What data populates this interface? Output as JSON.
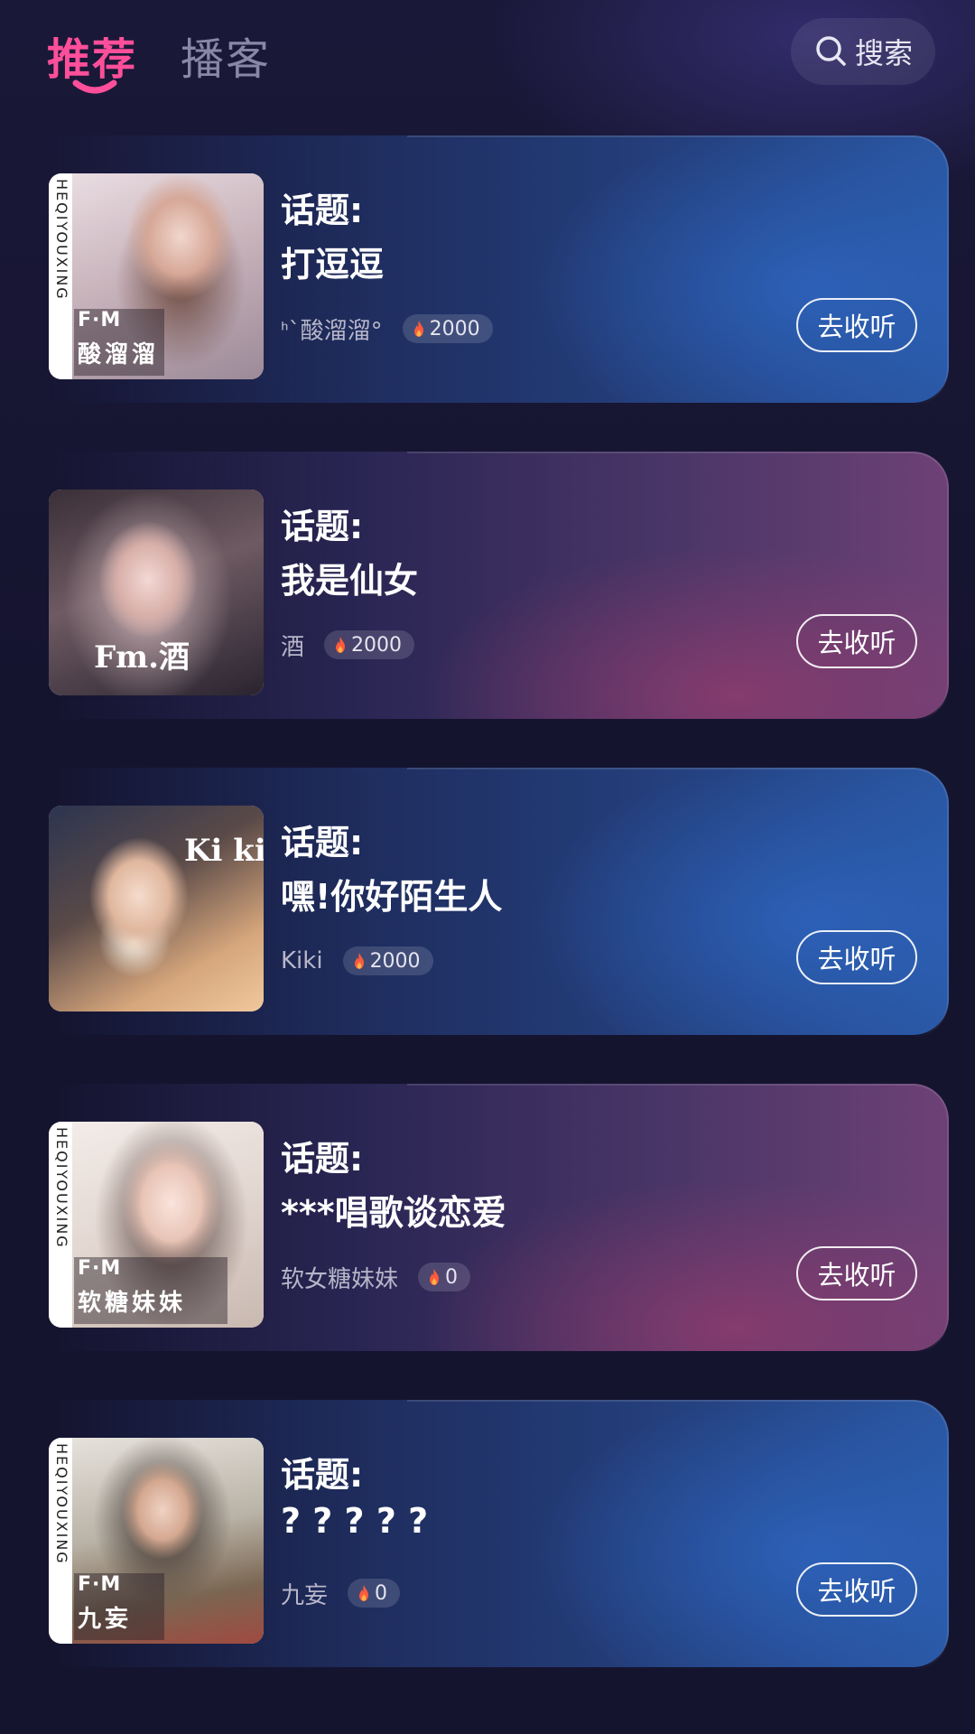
{
  "header": {
    "tabs": [
      {
        "label": "推荐",
        "active": true
      },
      {
        "label": "播客",
        "active": false
      }
    ],
    "search_label": "搜索",
    "accent_color": "#ff4f9a"
  },
  "cards": [
    {
      "topic_label": "话题:",
      "title": "打逗逗",
      "host": "ᑋ`酸溜溜°",
      "heat": "2000",
      "button": "去收听",
      "cover": {
        "side_text": "HEQIYOUXING",
        "fm": "F·M",
        "name": "酸溜溜"
      }
    },
    {
      "topic_label": "话题:",
      "title": "我是仙女",
      "host": "酒",
      "heat": "2000",
      "button": "去收听",
      "cover": {
        "side_text": "",
        "fm": "Fm.酒",
        "name": ""
      }
    },
    {
      "topic_label": "话题:",
      "title": "嘿!你好陌生人",
      "host": "Kiki",
      "heat": "2000",
      "button": "去收听",
      "cover": {
        "side_text": "",
        "fm": "Ki ki",
        "name": ""
      }
    },
    {
      "topic_label": "话题:",
      "title": "***唱歌谈恋爱",
      "host": "软女糖妹妹",
      "heat": "0",
      "button": "去收听",
      "cover": {
        "side_text": "HEQIYOUXING",
        "fm": "F·M",
        "name": "软糖妹妹"
      }
    },
    {
      "topic_label": "话题:",
      "title": "? ? ? ? ?",
      "host": "九妄",
      "heat": "0",
      "button": "去收听",
      "cover": {
        "side_text": "HEQIYOUXING",
        "fm": "F·M",
        "name": "九妄"
      }
    }
  ]
}
